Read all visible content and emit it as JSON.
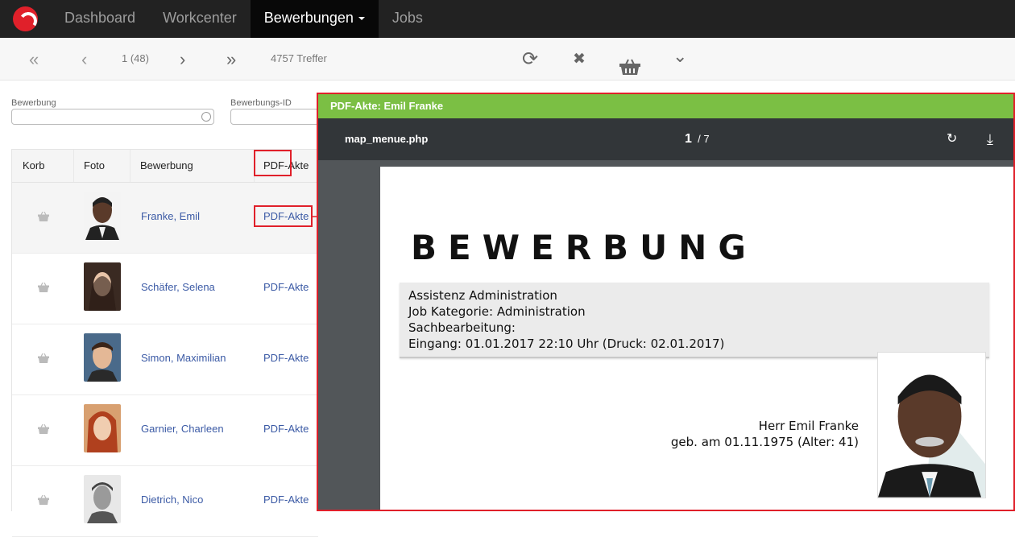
{
  "nav": {
    "items": [
      {
        "label": "Dashboard"
      },
      {
        "label": "Workcenter"
      },
      {
        "label": "Bewerbungen"
      },
      {
        "label": "Jobs"
      }
    ]
  },
  "toolbar": {
    "first_icon": "«",
    "prev_icon": "‹",
    "page_info": "1 (48)",
    "next_icon": "›",
    "last_icon": "»",
    "hits": "4757 Treffer",
    "refresh_icon": "⟳",
    "clear_icon": "✖",
    "expand_icon": "⌄"
  },
  "filters": {
    "bewerbung_label": "Bewerbung",
    "bewerbungs_id_label": "Bewerbungs-ID"
  },
  "table": {
    "headers": {
      "korb": "Korb",
      "foto": "Foto",
      "bewerbung": "Bewerbung",
      "pdf": "PDF-Akte"
    },
    "rows": [
      {
        "name": "Franke, Emil",
        "pdf": "PDF-Akte"
      },
      {
        "name": "Schäfer, Selena",
        "pdf": "PDF-Akte"
      },
      {
        "name": "Simon, Maximilian",
        "pdf": "PDF-Akte"
      },
      {
        "name": "Garnier, Charleen",
        "pdf": "PDF-Akte"
      },
      {
        "name": "Dietrich, Nico",
        "pdf": "PDF-Akte"
      }
    ]
  },
  "viewer": {
    "title": "PDF-Akte: Emil Franke",
    "filename": "map_menue.php",
    "page_current": "1",
    "page_total": "/ 7",
    "rotate_icon": "↻",
    "download_icon": "⤓",
    "doc": {
      "heading": "BEWERBUNG",
      "line1": "Assistenz Administration",
      "line2": "Job Kategorie: Administration",
      "line3": "Sachbearbeitung:",
      "line4": "Eingang: 01.01.2017 22:10 Uhr (Druck: 02.01.2017)",
      "person_name": "Herr Emil Franke",
      "person_birth": "geb. am 01.11.1975 (Alter: 41)"
    }
  },
  "colors": {
    "accent_red": "#e0202a",
    "viewer_green": "#7bbf44",
    "link_blue": "#3b5aa5"
  }
}
